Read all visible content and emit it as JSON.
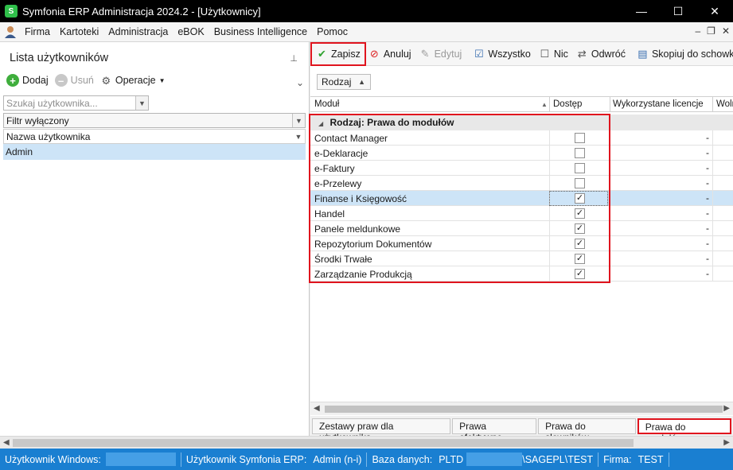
{
  "window": {
    "title": "Symfonia ERP Administracja 2024.2 - [Użytkownicy]",
    "controls": {
      "minimize": "—",
      "maximize": "☐",
      "close": "✕"
    }
  },
  "menu": {
    "items": [
      "Firma",
      "Kartoteki",
      "Administracja",
      "eBOK",
      "Business Intelligence",
      "Pomoc"
    ],
    "mdi": {
      "minimize": "–",
      "restore": "❐",
      "close": "✕"
    }
  },
  "left_panel": {
    "title": "Lista użytkowników",
    "pin": "📌",
    "toolbar": {
      "add": "Dodaj",
      "remove": "Usuń",
      "operations": "Operacje"
    },
    "search_placeholder": "Szukaj użytkownika...",
    "filter": "Filtr wyłączony",
    "column_header": "Nazwa użytkownika",
    "users": [
      "Admin"
    ]
  },
  "right_panel": {
    "toolbar": {
      "save": "Zapisz",
      "cancel": "Anuluj",
      "edit": "Edytuj",
      "all": "Wszystko",
      "none": "Nic",
      "invert": "Odwróć",
      "copy": "Skopiuj do schowka"
    },
    "group_button": "Rodzaj",
    "columns": {
      "module": "Moduł",
      "access": "Dostęp",
      "used_licenses": "Wykorzystane licencje",
      "free": "Woln"
    },
    "group_label": "Rodzaj: Prawa do modułów",
    "modules": [
      {
        "name": "Contact Manager",
        "access": false,
        "licenses": "-"
      },
      {
        "name": "e-Deklaracje",
        "access": false,
        "licenses": "-"
      },
      {
        "name": "e-Faktury",
        "access": false,
        "licenses": "-"
      },
      {
        "name": "e-Przelewy",
        "access": false,
        "licenses": "-"
      },
      {
        "name": "Finanse i Księgowość",
        "access": true,
        "licenses": "-",
        "selected": true
      },
      {
        "name": "Handel",
        "access": true,
        "licenses": "-"
      },
      {
        "name": "Panele meldunkowe",
        "access": true,
        "licenses": "-"
      },
      {
        "name": "Repozytorium Dokumentów",
        "access": true,
        "licenses": "-"
      },
      {
        "name": "Środki Trwałe",
        "access": true,
        "licenses": "-"
      },
      {
        "name": "Zarządzanie Produkcją",
        "access": true,
        "licenses": "-"
      }
    ],
    "tabs": [
      "Zestawy praw dla użytkownika",
      "Prawa efektywne",
      "Prawa do słowników",
      "Prawa do modułów"
    ],
    "active_tab": "Prawa do modułów"
  },
  "statusbar": {
    "windows_user_label": "Użytkownik Windows:",
    "symfonia_user_label": "Użytkownik Symfonia ERP:",
    "symfonia_user_value": "Admin (n-i)",
    "db_label": "Baza danych:",
    "db_prefix": "PLTD",
    "db_suffix": "\\SAGEPL\\TEST",
    "company_label": "Firma:",
    "company_value": "TEST"
  },
  "colors": {
    "accent": "#1a7fd1",
    "highlight_red": "#e0141e",
    "selection": "#cde4f7"
  }
}
